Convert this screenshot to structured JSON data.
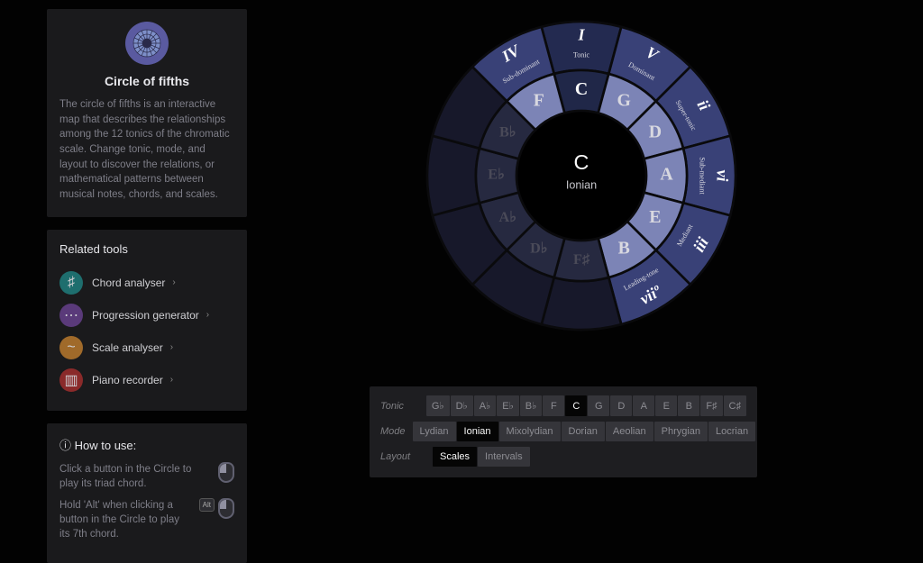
{
  "intro": {
    "title": "Circle of fifths",
    "body": "The circle of fifths is an interactive map that describes the relationships among the 12 tonics of the chromatic scale. Change tonic, mode, and layout to discover the relations, or mathematical patterns between musical notes, chords, and scales."
  },
  "related": {
    "heading": "Related tools",
    "items": [
      {
        "label": "Chord analyser",
        "color": "#1e6e6e",
        "glyph": "♯"
      },
      {
        "label": "Progression generator",
        "color": "#5a3a7a",
        "glyph": "⋯"
      },
      {
        "label": "Scale analyser",
        "color": "#a06a2a",
        "glyph": "~"
      },
      {
        "label": "Piano recorder",
        "color": "#8a2a2a",
        "glyph": "▥"
      }
    ]
  },
  "howto": {
    "heading": "How to use:",
    "step1": "Click a button in the Circle to play its triad chord.",
    "step2": "Hold 'Alt' when clicking a button in the Circle to play its 7th chord.",
    "altkey": "Alt"
  },
  "circle": {
    "center_tonic": "C",
    "center_mode": "Ionian",
    "inner_notes": [
      "C",
      "G",
      "D",
      "A",
      "E",
      "B",
      "F♯",
      "D♭",
      "A♭",
      "E♭",
      "B♭",
      "F"
    ],
    "outer_degrees": [
      {
        "roman": "I",
        "func": "Tonic"
      },
      {
        "roman": "V",
        "func": "Dominant"
      },
      {
        "roman": "ii",
        "func": "Super-tonic"
      },
      {
        "roman": "vi",
        "func": "Sub-mediant"
      },
      {
        "roman": "iii",
        "func": "Mediant"
      },
      {
        "roman": "viiº",
        "func": "Leading-tone"
      },
      {
        "roman": "",
        "func": ""
      },
      {
        "roman": "",
        "func": ""
      },
      {
        "roman": "",
        "func": ""
      },
      {
        "roman": "",
        "func": ""
      },
      {
        "roman": "",
        "func": ""
      },
      {
        "roman": "IV",
        "func": "Sub-dominant"
      }
    ],
    "active_indices": [
      0,
      1,
      2,
      3,
      4,
      5,
      11
    ]
  },
  "controls": {
    "tonic_label": "Tonic",
    "mode_label": "Mode",
    "layout_label": "Layout",
    "tonics": [
      "G♭",
      "D♭",
      "A♭",
      "E♭",
      "B♭",
      "F",
      "C",
      "G",
      "D",
      "A",
      "E",
      "B",
      "F♯",
      "C♯"
    ],
    "tonic_active": "C",
    "modes": [
      "Lydian",
      "Ionian",
      "Mixolydian",
      "Dorian",
      "Aeolian",
      "Phrygian",
      "Locrian"
    ],
    "mode_active": "Ionian",
    "layouts": [
      "Scales",
      "Intervals"
    ],
    "layout_active": "Scales"
  }
}
